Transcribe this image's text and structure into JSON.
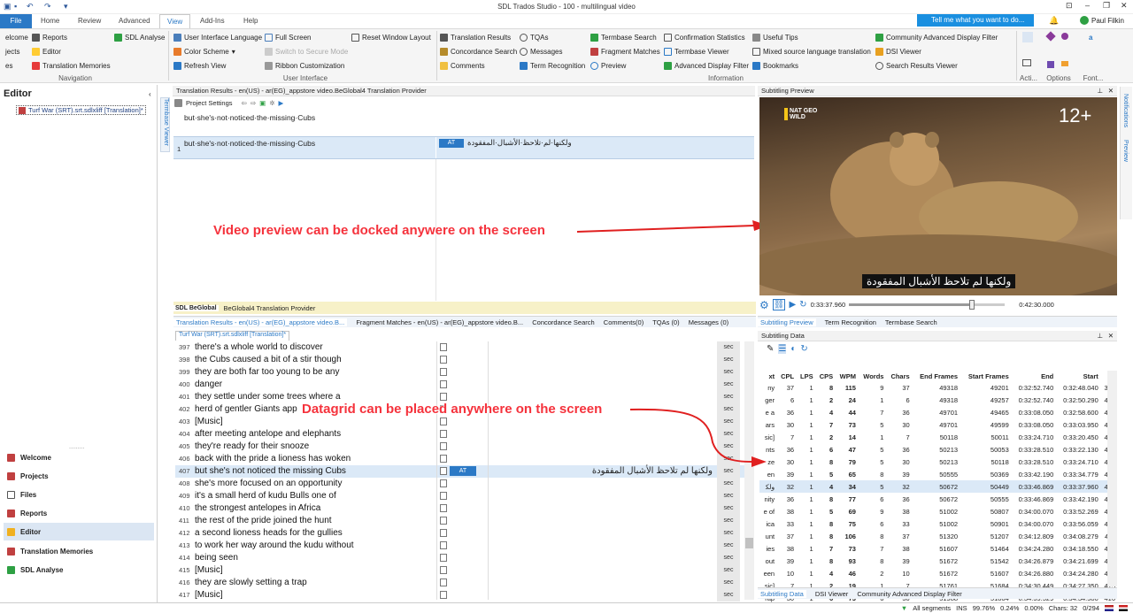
{
  "window": {
    "title": "SDL Trados Studio - 100 - multilingual video",
    "user": "Paul Filkin",
    "tell_me": "Tell me what you want to do..."
  },
  "tabs": [
    "File",
    "Home",
    "Review",
    "Advanced",
    "View",
    "Add-Ins",
    "Help"
  ],
  "ribbon": {
    "col1": [
      "elcome",
      "jects",
      "es"
    ],
    "col2": [
      "Reports",
      "Editor",
      "Translation Memories"
    ],
    "sdl_analyse": "SDL Analyse",
    "view_col": [
      "User Interface Language",
      "Color Scheme",
      "Refresh View"
    ],
    "view_col2": [
      "Full Screen",
      "Switch to Secure Mode",
      "Ribbon Customization"
    ],
    "reset": "Reset Window Layout",
    "panes_col1": [
      "Translation Results",
      "Concordance Search",
      "Comments"
    ],
    "panes_col2": [
      "TQAs",
      "Messages",
      "Term Recognition"
    ],
    "panes_col3": [
      "Termbase Search",
      "Fragment Matches",
      "Preview"
    ],
    "panes_col4": [
      "Confirmation Statistics",
      "Termbase Viewer",
      "Advanced Display Filter"
    ],
    "panes_col5": [
      "Useful Tips",
      "Mixed source language translation",
      "Bookmarks"
    ],
    "panes_col6": [
      "Community Advanced Display Filter",
      "DSI Viewer",
      "Search Results Viewer"
    ],
    "groups": {
      "navigation": "Navigation",
      "user_interface": "User Interface",
      "information": "Information",
      "actions": "Acti...",
      "options": "Options",
      "font": "Font..."
    }
  },
  "left_panel": {
    "title": "Editor",
    "file": "Turf War (SRT).srt.sdlxliff [Translation]*",
    "nav": [
      "Welcome",
      "Projects",
      "Files",
      "Reports",
      "Editor",
      "Translation Memories",
      "SDL Analyse"
    ]
  },
  "translation_results": {
    "header": "Translation Results - en(US) - ar(EG)_appstore video.BeGlobal4 Translation Provider",
    "project_settings": "Project Settings",
    "source_line": "but·she's·not·noticed·the·missing·Cubs",
    "seg_num": "1",
    "seg_source": "but·she's·not·noticed·the·missing·Cubs",
    "seg_badge": "AT",
    "seg_target": "ولكنها·لم·تلاحظ·الأشبال·المفقودة",
    "provider_logo": "SDL BeGlobal",
    "provider_name": "BeGlobal4 Translation Provider",
    "side_tab": "Termbase Viewer"
  },
  "middle_tabs": [
    "Translation Results - en(US) - ar(EG)_appstore video.B...",
    "Fragment Matches - en(US) - ar(EG)_appstore video.B...",
    "Concordance Search",
    "Comments(0)",
    "TQAs (0)",
    "Messages (0)"
  ],
  "grid": {
    "doc_tab": "Turf War (SRT).srt.sdlxliff [Translation]*",
    "rows": [
      {
        "n": "397",
        "s": "there's a whole world to discover"
      },
      {
        "n": "398",
        "s": "the Cubs caused a bit of a stir though"
      },
      {
        "n": "399",
        "s": "they are both far too young to be any"
      },
      {
        "n": "400",
        "s": "danger"
      },
      {
        "n": "401",
        "s": "they settle under some trees where a"
      },
      {
        "n": "402",
        "s": "herd of gentler Giants app"
      },
      {
        "n": "403",
        "s": "[Music]"
      },
      {
        "n": "404",
        "s": "after meeting antelope and elephants"
      },
      {
        "n": "405",
        "s": "they're ready for their snooze"
      },
      {
        "n": "406",
        "s": "back with the pride a lioness has woken"
      },
      {
        "n": "407",
        "s": "but she's not noticed the missing Cubs"
      },
      {
        "n": "408",
        "s": "she's more focused on an opportunity"
      },
      {
        "n": "409",
        "s": "it's a small herd of kudu Bulls one of"
      },
      {
        "n": "410",
        "s": "the strongest antelopes in Africa"
      },
      {
        "n": "411",
        "s": "the rest of the pride joined the hunt"
      },
      {
        "n": "412",
        "s": "a second lioness heads for the gullies"
      },
      {
        "n": "413",
        "s": "to work her way around the kudu without"
      },
      {
        "n": "414",
        "s": "being seen"
      },
      {
        "n": "415",
        "s": "[Music]"
      },
      {
        "n": "416",
        "s": "they are slowly setting a trap"
      },
      {
        "n": "417",
        "s": "[Music]"
      }
    ],
    "sec_label": "sec",
    "sel_badge": "AT",
    "sel_target": "ولكنها لم تلاحظ الأشبال المفقودة"
  },
  "preview": {
    "header": "Subtitling Preview",
    "channel": "NAT GEO WILD",
    "rating": "12+",
    "subtitle": "ولكنها لم تلاحظ الأشبال المفقودة",
    "time_current": "0:33:37.960",
    "time_total": "0:42:30.000",
    "position_fraction": 0.79,
    "tabs": [
      "Subtitling Preview",
      "Term Recognition",
      "Termbase Search"
    ]
  },
  "subtitling_data": {
    "header": "Subtitling Data",
    "columns": [
      "xt",
      "CPL",
      "LPS",
      "CPS",
      "WPM",
      "Words",
      "Chars",
      "End Frames",
      "Start Frames",
      "End",
      "Start"
    ],
    "rows": [
      [
        "ny",
        "37",
        "1",
        "8",
        "115",
        "9",
        "37",
        "49318",
        "49201",
        "0:32:52.740",
        "0:32:48.040",
        "399"
      ],
      [
        "ger",
        "6",
        "1",
        "2",
        "24",
        "1",
        "6",
        "49318",
        "49257",
        "0:32:52.740",
        "0:32:50.290",
        "400"
      ],
      [
        "e a",
        "36",
        "1",
        "4",
        "44",
        "7",
        "36",
        "49701",
        "49465",
        "0:33:08.050",
        "0:32:58.600",
        "401"
      ],
      [
        "ars",
        "30",
        "1",
        "7",
        "73",
        "5",
        "30",
        "49701",
        "49599",
        "0:33:08.050",
        "0:33:03.950",
        "402"
      ],
      [
        "sic]",
        "7",
        "1",
        "2",
        "14",
        "1",
        "7",
        "50118",
        "50011",
        "0:33:24.710",
        "0:33:20.450",
        "403"
      ],
      [
        "nts",
        "36",
        "1",
        "6",
        "47",
        "5",
        "36",
        "50213",
        "50053",
        "0:33:28.510",
        "0:33:22.130",
        "404"
      ],
      [
        "ze",
        "30",
        "1",
        "8",
        "79",
        "5",
        "30",
        "50213",
        "50118",
        "0:33:28.510",
        "0:33:24.710",
        "405"
      ],
      [
        "en",
        "39",
        "1",
        "5",
        "65",
        "8",
        "39",
        "50555",
        "50369",
        "0:33:42.190",
        "0:33:34.779",
        "406"
      ],
      [
        "ﻭﻟﻜ",
        "32",
        "1",
        "4",
        "34",
        "5",
        "32",
        "50672",
        "50449",
        "0:33:46.869",
        "0:33:37.960",
        "407"
      ],
      [
        "nity",
        "36",
        "1",
        "8",
        "77",
        "6",
        "36",
        "50672",
        "50555",
        "0:33:46.869",
        "0:33:42.190",
        "408"
      ],
      [
        "e of",
        "38",
        "1",
        "5",
        "69",
        "9",
        "38",
        "51002",
        "50807",
        "0:34:00.070",
        "0:33:52.269",
        "409"
      ],
      [
        "ica",
        "33",
        "1",
        "8",
        "75",
        "6",
        "33",
        "51002",
        "50901",
        "0:34:00.070",
        "0:33:56.059",
        "410"
      ],
      [
        "unt",
        "37",
        "1",
        "8",
        "106",
        "8",
        "37",
        "51320",
        "51207",
        "0:34:12.809",
        "0:34:08.279",
        "411"
      ],
      [
        "ies",
        "38",
        "1",
        "7",
        "73",
        "7",
        "38",
        "51607",
        "51464",
        "0:34:24.280",
        "0:34:18.550",
        "412"
      ],
      [
        "out",
        "39",
        "1",
        "8",
        "93",
        "8",
        "39",
        "51672",
        "51542",
        "0:34:26.879",
        "0:34:21.699",
        "413"
      ],
      [
        "een",
        "10",
        "1",
        "4",
        "46",
        "2",
        "10",
        "51672",
        "51607",
        "0:34:26.880",
        "0:34:24.280",
        "414"
      ],
      [
        "sic]",
        "7",
        "1",
        "2",
        "19",
        "1",
        "7",
        "51761",
        "51684",
        "0:34:30.449",
        "0:34:27.350",
        "415"
      ],
      [
        "rap",
        "30",
        "1",
        "6",
        "73",
        "6",
        "30",
        "51988",
        "51864",
        "0:34:39.529",
        "0:34:34.580",
        "416"
      ],
      [
        "sic]",
        "7",
        "1",
        "7",
        "7",
        "1",
        "7",
        "52192",
        "52081",
        "0:34:47.668",
        "0:34:43.250",
        "417"
      ]
    ],
    "selected_index": 8,
    "tabs": [
      "Subtitling Data",
      "DSI Viewer",
      "Community Advanced Display Filter"
    ]
  },
  "annotations": {
    "preview_note": "Video preview can be docked anywere on the screen",
    "grid_note": "Datagrid can be placed anywhere on the screen"
  },
  "right_side_tabs": [
    "Notifications",
    "Preview"
  ],
  "status": {
    "filter": "All segments",
    "ins": "INS",
    "pct1": "99.76%",
    "pct2": "0.24%",
    "pct3": "0.00%",
    "chars": "Chars: 32",
    "pos": "0/294"
  }
}
